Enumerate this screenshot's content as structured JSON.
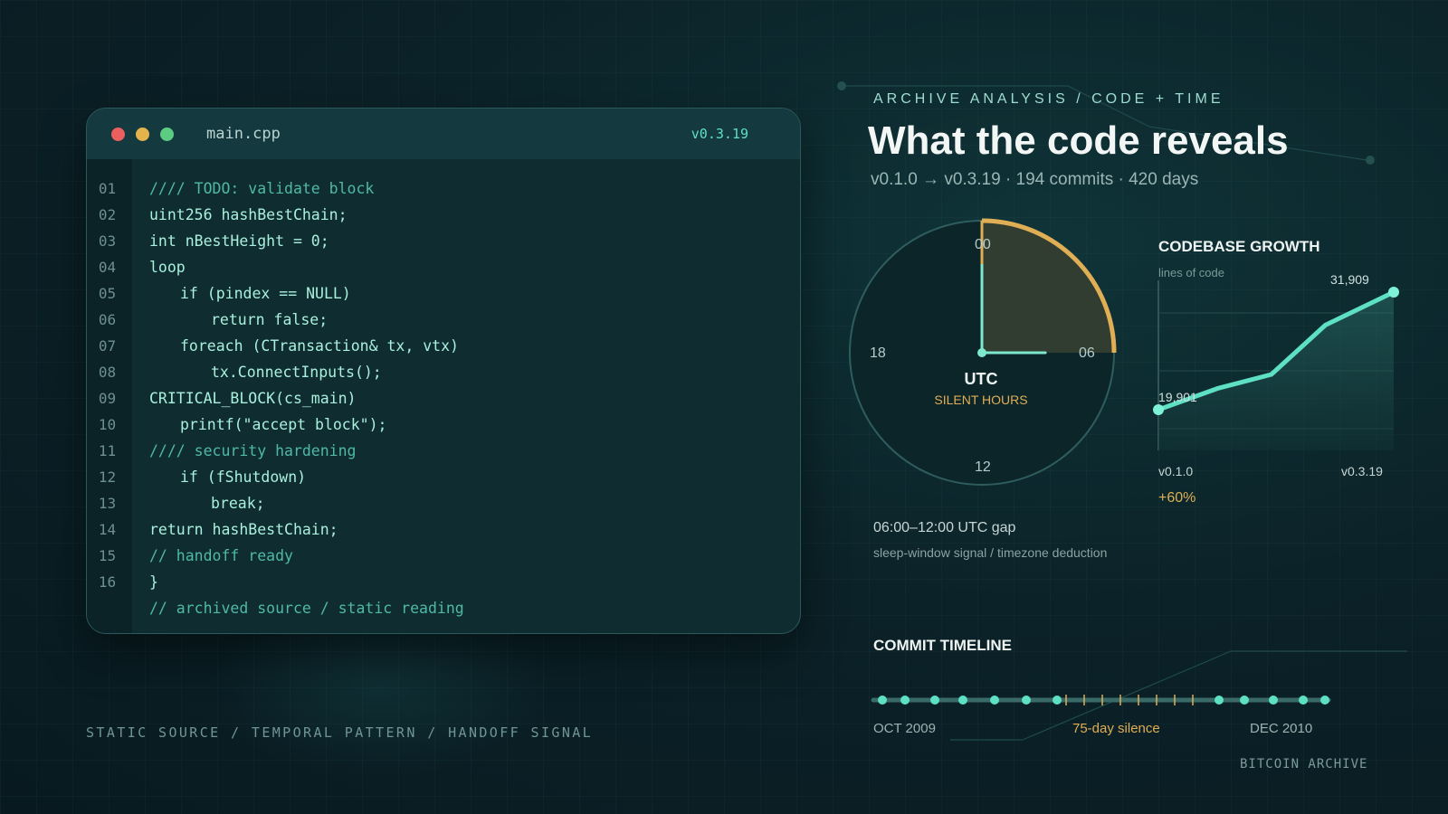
{
  "editor": {
    "filename": "main.cpp",
    "version": "v0.3.19",
    "lines": [
      {
        "n": "01",
        "text": "//// TODO: validate block",
        "indent": 0
      },
      {
        "n": "02",
        "text": "uint256 hashBestChain;",
        "indent": 0
      },
      {
        "n": "03",
        "text": "int nBestHeight = 0;",
        "indent": 0
      },
      {
        "n": "04",
        "text": "loop",
        "indent": 0
      },
      {
        "n": "05",
        "text": "if (pindex == NULL)",
        "indent": 1
      },
      {
        "n": "06",
        "text": "return false;",
        "indent": 2
      },
      {
        "n": "07",
        "text": "foreach (CTransaction& tx, vtx)",
        "indent": 1
      },
      {
        "n": "08",
        "text": "tx.ConnectInputs();",
        "indent": 2
      },
      {
        "n": "09",
        "text": "CRITICAL_BLOCK(cs_main)",
        "indent": 0
      },
      {
        "n": "10",
        "text": "printf(\"accept block\");",
        "indent": 1
      },
      {
        "n": "11",
        "text": "//// security hardening",
        "indent": 0
      },
      {
        "n": "12",
        "text": "if (fShutdown)",
        "indent": 1
      },
      {
        "n": "13",
        "text": "break;",
        "indent": 2
      },
      {
        "n": "14",
        "text": "return hashBestChain;",
        "indent": 0
      },
      {
        "n": "15",
        "text": "// handoff ready",
        "indent": 0
      },
      {
        "n": "16",
        "text": "}",
        "indent": 0
      }
    ],
    "footer_comment": "// archived source / static reading"
  },
  "footer_left": "STATIC SOURCE / TEMPORAL PATTERN / HANDOFF SIGNAL",
  "header": {
    "eyebrow": "ARCHIVE ANALYSIS / CODE + TIME",
    "title": "What the code reveals",
    "subtitle": "v0.1.0 → v0.3.19 · 194 commits · 420 days"
  },
  "clock": {
    "labels": {
      "top": "00",
      "right": "06",
      "bottom": "12",
      "left": "18"
    },
    "center_label": "UTC",
    "highlight_label": "SILENT HOURS",
    "silent_start_hour": 0,
    "silent_end_hour": 6,
    "hand_hour": 6,
    "accent_color": "#e0ae55",
    "hand_color": "#7ee8cf",
    "gap_title": "06:00–12:00 UTC gap",
    "gap_subtitle": "sleep-window signal / timezone deduction"
  },
  "growth": {
    "title": "CODEBASE GROWTH",
    "ylabel": "lines of code",
    "start_label": "19,901",
    "end_label": "31,909",
    "x_start": "v0.1.0",
    "x_end": "v0.3.19",
    "change": "+60%",
    "points": [
      0,
      0.25,
      0.5,
      0.72,
      1
    ],
    "line_color": "#5ee0c4"
  },
  "timeline": {
    "title": "COMMIT TIMELINE",
    "start_label": "OCT 2009",
    "silence_label": "75-day silence",
    "end_label": "DEC 2010",
    "commits_before": 8,
    "silence_ticks": 7,
    "commits_after": 5
  },
  "footer_right": "BITCOIN ARCHIVE"
}
